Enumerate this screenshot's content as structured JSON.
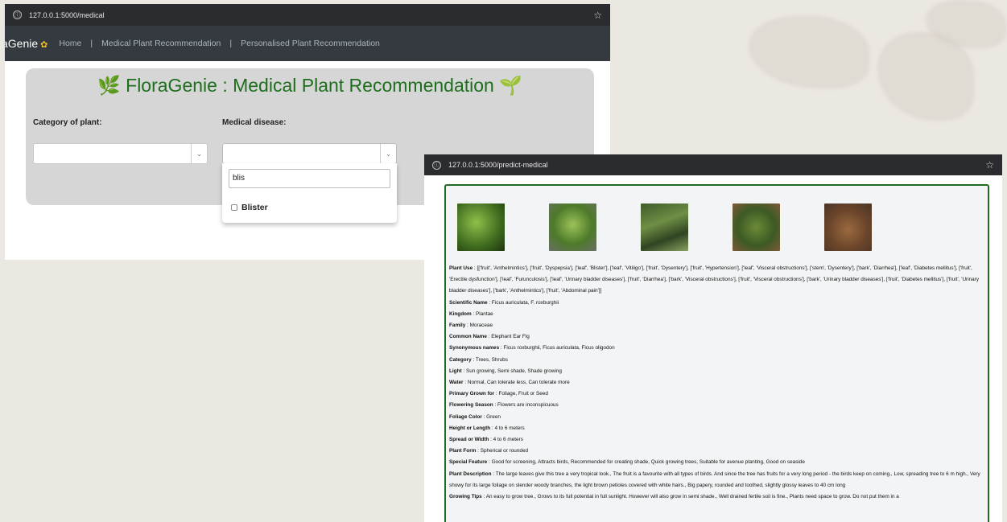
{
  "window1": {
    "url": "127.0.0.1:5000/medical",
    "brand": "aGenie",
    "nav": {
      "home": "Home",
      "medical": "Medical Plant Recommendation",
      "personalised": "Personalised Plant Recommendation"
    },
    "title": "🌿 FloraGenie : Medical Plant Recommendation 🌱",
    "category_label": "Category of plant:",
    "disease_label": "Medical disease:",
    "search_value": "blis",
    "option": "Blister"
  },
  "window2": {
    "url": "127.0.0.1:5000/predict-medical",
    "details": [
      {
        "label": "Plant Use",
        "value": "[['fruit', 'Anthelmintics'], ['fruit', 'Dyspepsia'], ['leaf', 'Blister'], ['leaf', 'Vitiligo'], ['fruit', 'Dysentery'], ['fruit', 'Hypertension'], ['leaf', 'Visceral obstructions'], ['stem', 'Dysentery'], ['bark', 'Diarrhea'], ['leaf', 'Diabetes mellitus'], ['fruit', 'Erectile dysfunction'], ['leaf', 'Furunculosis'], ['leaf', 'Urinary bladder diseases'], ['fruit', 'Diarrhea'], ['bark', 'Visceral obstructions'], ['fruit', 'Visceral obstructions'], ['bark', 'Urinary bladder diseases'], ['fruit', 'Diabetes mellitus'], ['fruit', 'Urinary bladder diseases'], ['bark', 'Anthelmintics'], ['fruit', 'Abdominal pain']]"
      },
      {
        "label": "Scientific Name",
        "value": "Ficus auriculata, F. roxburghii"
      },
      {
        "label": "Kingdom",
        "value": "Plantae"
      },
      {
        "label": "Family",
        "value": "Moraceae"
      },
      {
        "label": "Common Name",
        "value": "Elephant Ear Fig"
      },
      {
        "label": "Synonymous names",
        "value": "Ficus roxburghii, Ficus auriculata, Ficus oligodon"
      },
      {
        "label": "Category",
        "value": "Trees, Shrubs"
      },
      {
        "label": "Light",
        "value": "Sun growing, Semi shade, Shade growing"
      },
      {
        "label": "Water",
        "value": "Normal, Can tolerate less, Can tolerate more"
      },
      {
        "label": "Primary Grown for",
        "value": "Foliage, Fruit or Seed"
      },
      {
        "label": "Flowering Season",
        "value": "Flowers are inconspicuous"
      },
      {
        "label": "Foliage Color",
        "value": "Green"
      },
      {
        "label": "Height or Length",
        "value": "4 to 6 meters"
      },
      {
        "label": "Spread or Width",
        "value": "4 to 6 meters"
      },
      {
        "label": "Plant Form",
        "value": "Spherical or rounded"
      },
      {
        "label": "Special Feature",
        "value": "Good for screening, Attracts birds, Recommended for creating shade, Quick growing trees, Suitable for avenue planting, Good on seaside"
      },
      {
        "label": "Plant Description",
        "value": "The large leaves give this tree a very tropical look., The fruit is a favourite with all types of birds. And since the tree has fruits for a very long period - the birds keep on coming., Low, spreading tree to 6 m high., Very showy for its large foliage on slender woody branches, the light brown petioles covered with white hairs., Big papery, rounded and toothed, slightly glossy leaves to 40 cm long"
      },
      {
        "label": "Growing Tips",
        "value": "An easy to grow tree., Grows to its full potential in full sunlight. However will also grow in semi shade., Well drained fertile soil is fine., Plants need space to grow. Do not put them in a"
      }
    ]
  }
}
